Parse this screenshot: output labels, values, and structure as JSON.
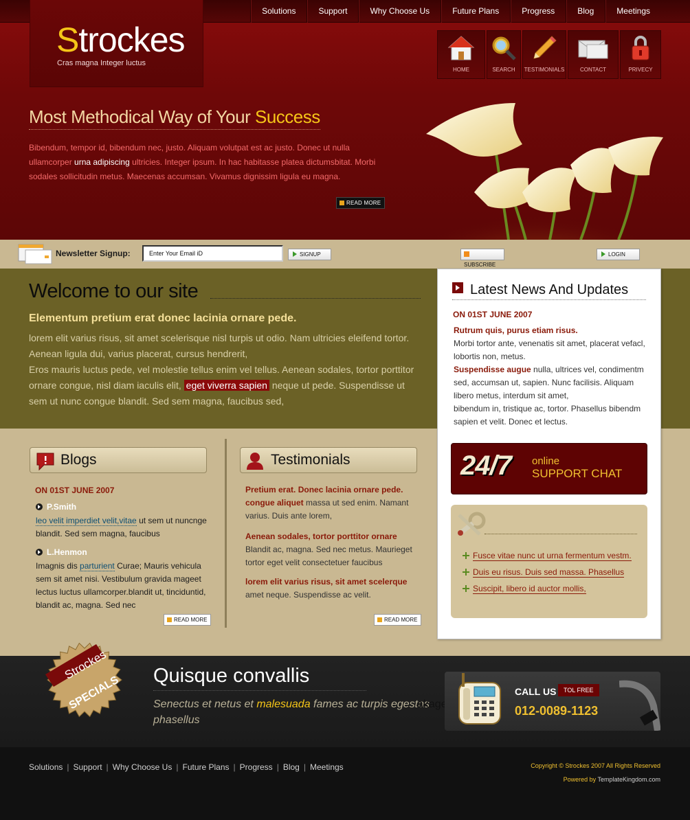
{
  "topnav": [
    "Solutions",
    "Support",
    "Why Choose Us",
    "Future Plans",
    "Progress",
    "Blog",
    "Meetings"
  ],
  "logo": {
    "first": "S",
    "rest": "trockes",
    "tagline": "Cras magna Integer luctus"
  },
  "iconbar": [
    {
      "icon": "home-icon",
      "label": "HOME"
    },
    {
      "icon": "search-icon",
      "label": "SEARCH"
    },
    {
      "icon": "pencil-icon",
      "label": "TESTIMONIALS"
    },
    {
      "icon": "mail-icon",
      "label": "CONTACT"
    },
    {
      "icon": "lock-icon",
      "label": "PRIVECY"
    }
  ],
  "hero": {
    "title_a": "Most Methodical Way of Your ",
    "title_b": "Success",
    "text_a": "Bibendum, tempor id, bibendum nec, justo. Aliquam volutpat est ac justo. Donec ut nulla ullamcorper ",
    "text_hl": "urna adipiscing",
    "text_b": " ultricies. Integer ipsum. In hac habitasse platea dictumsbitat. Morbi sodales sollicitudin metus. Maecenas accumsan. Vivamus dignissim ligula eu magna.",
    "read_more": "READ MORE"
  },
  "newsletter": {
    "label": "Newsletter Signup:",
    "input_value": "Enter Your Email iD",
    "signup": "SIGNUP",
    "subscribe": "SUBSCRIBE",
    "login": "LOGIN"
  },
  "welcome": {
    "title": "Welcome to our site",
    "subtitle": "Elementum pretium erat donec lacinia ornare pede.",
    "p1": "lorem elit varius risus, sit amet scelerisque nisl turpis ut odio. Nam ultricies eleifend tortor. Aenean ligula dui, varius placerat, cursus hendrerit,",
    "p2a": "Eros mauris luctus pede, vel molestie tellus enim vel tellus. Aenean sodales, tortor porttitor ornare congue, nisl diam iaculis elit, ",
    "p2hl": "eget viverra sapien",
    "p2b": " neque ut pede. Suspendisse ut sem ut nunc congue blandit. Sed sem magna, faucibus sed,"
  },
  "blogs": {
    "title": "Blogs",
    "date": "ON 01ST JUNE 2007",
    "entries": [
      {
        "name": "P.Smith",
        "link": "leo velit imperdiet velit,vitae",
        "text": " ut sem ut nuncnge blandit. Sed sem magna, faucibus"
      },
      {
        "name": "L.Henmon",
        "text_a": "Imagnis dis ",
        "link": "parturient",
        "text_b": "  Curae; Mauris vehicula sem sit amet nisi. Vestibulum gravida mageet lectus luctus ullamcorper.blandit ut, tinciduntid, blandit ac, magna. Sed nec"
      }
    ],
    "read_more": "READ MORE"
  },
  "testimonials": {
    "title": "Testimonials",
    "entries": [
      {
        "bold": "Pretium erat. Donec lacinia ornare pede. congue aliquet",
        "text": " massa ut sed enim. Namant varius. Duis ante lorem,"
      },
      {
        "bold": "Aenean sodales, tortor porttitor ornare",
        "text": "Blandit ac, magna. Sed nec metus. Maurieget tortor eget velit consectetuer faucibus"
      },
      {
        "bold": "lorem elit varius risus, sit amet scelerque",
        "text": "amet neque. Suspendisse ac velit."
      }
    ],
    "read_more": "READ MORE"
  },
  "news": {
    "title": "Latest News And Updates",
    "date": "ON 01ST JUNE 2007",
    "bold1": "Rutrum quis, purus etiam risus.",
    "text1": "Morbi tortor ante, venenatis sit amet, placerat vefacl, lobortis non, metus.",
    "bold2": "Suspendisse augue",
    "text2": " nulla, ultrices vel, condimentm sed, accumsan ut, sapien. Nunc facilisis. Aliquam libero metus, interdum sit amet,",
    "text3": "bibendum in, tristique ac, tortor. Phasellus bibendm sapien et velit. Donec et lectus."
  },
  "chat": {
    "big": "24/7",
    "online": "online",
    "support": "SUPPORT CHAT"
  },
  "quicklinks": [
    "Fusce vitae nunc ut urna fermentum vestm.",
    "Duis eu risus. Duis sed massa. Phasellus",
    "Suscipit, libero id auctor mollis,"
  ],
  "specials": {
    "badge_brand": "Strockes",
    "badge_text": "SPECIALS",
    "title": "Quisque convallis",
    "text_a": "Senectus et netus et ",
    "text_hl": "malesuada",
    "text_b": " fames ac turpis egestas phasellus",
    "overlay": "akages"
  },
  "call": {
    "label": "CALL US",
    "tollfree": "TOL FREE",
    "number": "012-0089-1123"
  },
  "footer": {
    "nav": [
      "Solutions",
      "Support",
      "Why Choose Us",
      "Future Plans",
      "Progress",
      "Blog",
      "Meetings"
    ],
    "copyright": "Copyright © Strockes 2007 All Rights Reserved",
    "powered_a": "Powered by ",
    "powered_b": "TemplateKingdom.com"
  },
  "colors": {
    "brand_red": "#7a0a0a",
    "gold": "#f5c518",
    "olive": "#6b6126",
    "sand": "#c9b892"
  }
}
